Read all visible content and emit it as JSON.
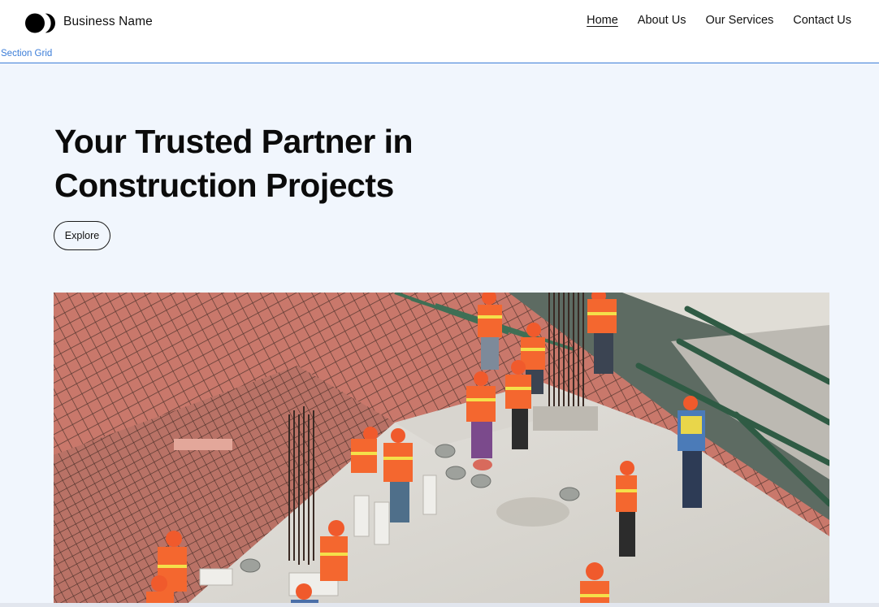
{
  "header": {
    "logo_icon": "two-circles-logo-icon",
    "business_name": "Business Name",
    "nav": [
      {
        "label": "Home",
        "active": true
      },
      {
        "label": "About Us",
        "active": false
      },
      {
        "label": "Our Services",
        "active": false
      },
      {
        "label": "Contact Us",
        "active": false
      }
    ]
  },
  "editor": {
    "section_label": "Section Grid",
    "accent_color": "#3b7dd8"
  },
  "hero": {
    "title_line1": "Your Trusted Partner in",
    "title_line2": "Construction Projects",
    "cta_label": "Explore",
    "background_color": "#f1f6fd",
    "image_subject": "construction workers in orange safety vests and hard hats on a concrete slab with rebar"
  }
}
